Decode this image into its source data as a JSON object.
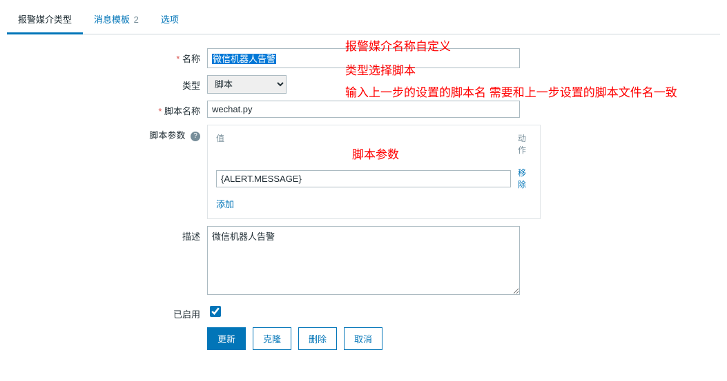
{
  "tabs": {
    "mediaType": "报警媒介类型",
    "msgTemplate": "消息模板",
    "msgTemplateCount": "2",
    "options": "选项"
  },
  "labels": {
    "name": "名称",
    "type": "类型",
    "scriptName": "脚本名称",
    "scriptParams": "脚本参数",
    "description": "描述",
    "enabled": "已启用"
  },
  "values": {
    "name": "微信机器人告警",
    "type": "脚本",
    "scriptName": "wechat.py",
    "param1": "{ALERT.MESSAGE}",
    "description": "微信机器人告警",
    "enabled": true
  },
  "paramsBox": {
    "colValue": "值",
    "colAction": "动作",
    "remove": "移除",
    "add": "添加"
  },
  "buttons": {
    "update": "更新",
    "clone": "克隆",
    "delete": "删除",
    "cancel": "取消"
  },
  "annotations": {
    "a1": "报警媒介名称自定义",
    "a2": "类型选择脚本",
    "a3": "输入上一步的设置的脚本名 需要和上一步设置的脚本文件名一致",
    "a4": "脚本参数"
  },
  "helpGlyph": "?"
}
